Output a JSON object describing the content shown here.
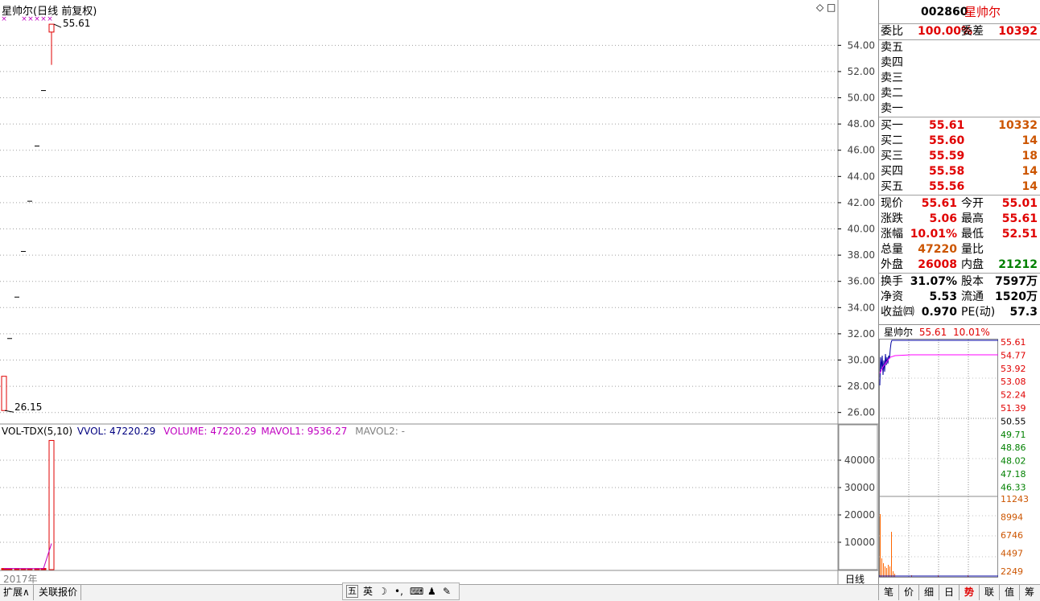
{
  "chart_header": {
    "title": "星帅尔(日线 前复权)",
    "diamond_icon": "◇",
    "square_icon": "□"
  },
  "main_chart": {
    "ticks": [
      "54.00",
      "52.00",
      "50.00",
      "48.00",
      "46.00",
      "44.00",
      "42.00",
      "40.00",
      "38.00",
      "36.00",
      "34.00",
      "32.00",
      "30.00",
      "28.00",
      "26.00"
    ],
    "high_label": "55.61",
    "low_label": "26.15"
  },
  "volume_panel": {
    "indicator": "VOL-TDX(5,10)",
    "vvol": "VVOL: 47220.29",
    "volume": "VOLUME: 47220.29",
    "mavol1": "MAVOL1: 9536.27",
    "mavol2": "MAVOL2: -",
    "ticks": [
      "40000",
      "30000",
      "20000",
      "10000"
    ]
  },
  "chart_data": {
    "type": "candlestick",
    "note_series": "daily k-line",
    "candles": [
      {
        "open": 26.15,
        "close": 28.76,
        "high": 28.76,
        "low": 26.15
      },
      {
        "open": 31.64,
        "close": 31.64,
        "high": 31.64,
        "low": 31.64
      },
      {
        "open": 34.8,
        "close": 34.8,
        "high": 34.8,
        "low": 34.8
      },
      {
        "open": 38.28,
        "close": 38.28,
        "high": 38.28,
        "low": 38.28
      },
      {
        "open": 42.11,
        "close": 42.11,
        "high": 42.11,
        "low": 42.11
      },
      {
        "open": 46.32,
        "close": 46.32,
        "high": 46.32,
        "low": 46.32
      },
      {
        "open": 50.55,
        "close": 50.55,
        "high": 50.55,
        "low": 50.55
      },
      {
        "open": 55.01,
        "close": 55.61,
        "high": 55.61,
        "low": 52.51
      }
    ],
    "volumes": [
      400,
      380,
      390,
      370,
      360,
      380,
      420,
      47220.29
    ],
    "mavol1": [
      400,
      390,
      390,
      385,
      380,
      376,
      380,
      9536.27
    ],
    "y_range": [
      25.0,
      56.0
    ],
    "vol_range": [
      0,
      50000
    ]
  },
  "axis": {
    "year_label": "2017年",
    "period_label": "日线"
  },
  "quote": {
    "code": "002860",
    "name": "星帅尔",
    "weibi_label": "委比",
    "weibi_value": "100.00%",
    "weicha_label": "委差",
    "weicha_value": "10392",
    "sell": [
      "卖五",
      "卖四",
      "卖三",
      "卖二",
      "卖一"
    ],
    "buy": [
      {
        "label": "买一",
        "price": "55.61",
        "vol": "10332"
      },
      {
        "label": "买二",
        "price": "55.60",
        "vol": "14"
      },
      {
        "label": "买三",
        "price": "55.59",
        "vol": "18"
      },
      {
        "label": "买四",
        "price": "55.58",
        "vol": "14"
      },
      {
        "label": "买五",
        "price": "55.56",
        "vol": "14"
      }
    ],
    "stats": [
      {
        "l1": "现价",
        "v1": "55.61",
        "c1": "red",
        "l2": "今开",
        "v2": "55.01",
        "c2": "red"
      },
      {
        "l1": "涨跌",
        "v1": "5.06",
        "c1": "red",
        "l2": "最高",
        "v2": "55.61",
        "c2": "red"
      },
      {
        "l1": "涨幅",
        "v1": "10.01%",
        "c1": "red",
        "l2": "最低",
        "v2": "52.51",
        "c2": "red"
      },
      {
        "l1": "总量",
        "v1": "47220",
        "c1": "orange",
        "l2": "量比",
        "v2": "",
        "c2": "black"
      },
      {
        "l1": "外盘",
        "v1": "26008",
        "c1": "red",
        "l2": "内盘",
        "v2": "21212",
        "c2": "green"
      }
    ],
    "fund": [
      {
        "l1": "换手",
        "v1": "31.07%",
        "l2": "股本",
        "v2": "7597万"
      },
      {
        "l1": "净资",
        "v1": "5.53",
        "l2": "流通",
        "v2": "1520万"
      },
      {
        "l1": "收益㈣",
        "v1": "0.970",
        "l2": "PE(动)",
        "v2": "57.3"
      }
    ]
  },
  "mini_chart": {
    "name": "星帅尔",
    "price": "55.61",
    "pct": "10.01%",
    "price_ticks": [
      "55.61",
      "54.77",
      "53.92",
      "53.08",
      "52.24",
      "51.39",
      "50.55",
      "49.71",
      "48.86",
      "48.02",
      "47.18",
      "46.33"
    ],
    "vol_ticks": [
      "11243",
      "8994",
      "6746",
      "4497",
      "2249"
    ]
  },
  "bottom_tabs": [
    "扩展∧",
    "关联报价"
  ],
  "ime": {
    "label1": "五",
    "label2": "英"
  },
  "panel_tabs": [
    "笔",
    "价",
    "细",
    "日",
    "势",
    "联",
    "值",
    "筹"
  ],
  "colors": {
    "up": "#e00000",
    "down": "#008000",
    "ma": "#c000c0",
    "avg": "#ff00ff",
    "grid": "#c0c0c0"
  }
}
